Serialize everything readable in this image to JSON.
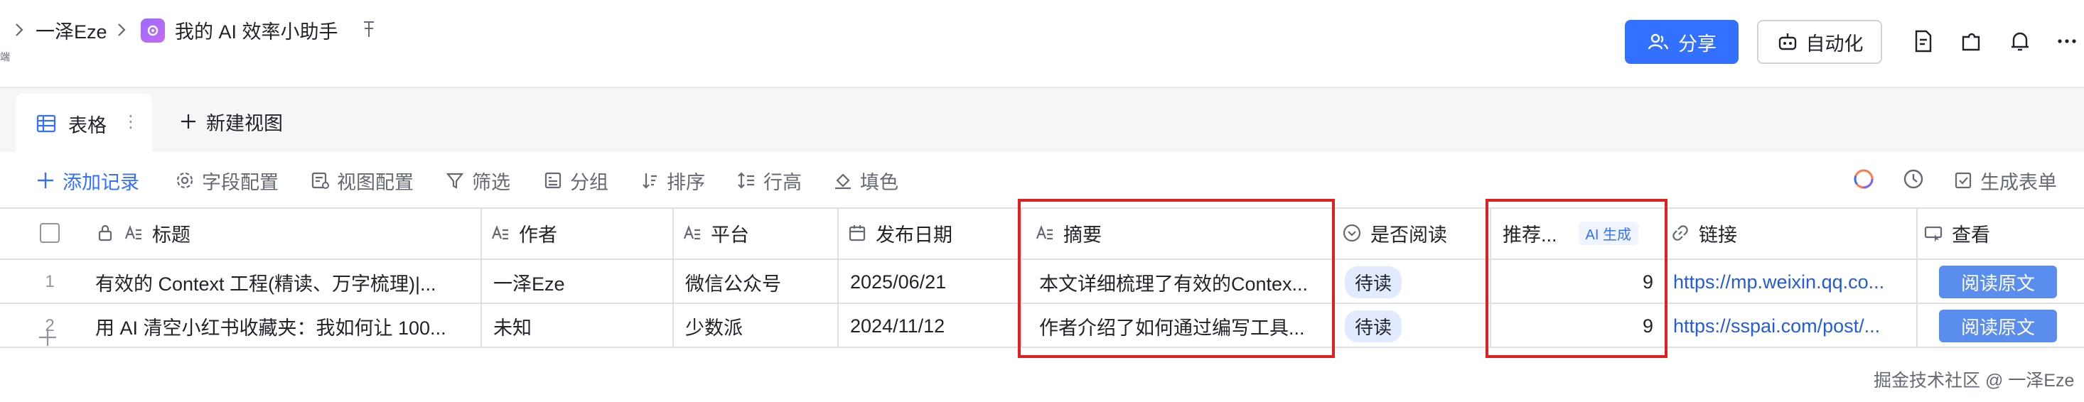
{
  "breadcrumb": {
    "parent": "一泽Eze",
    "title": "我的 AI 效率小助手"
  },
  "header": {
    "share_label": "分享",
    "automation_label": "自动化",
    "side_mark": "端"
  },
  "views": {
    "active_tab": "表格",
    "new_view": "新建视图"
  },
  "toolbar": {
    "add_record": "添加记录",
    "field_config": "字段配置",
    "view_config": "视图配置",
    "filter": "筛选",
    "group": "分组",
    "sort": "排序",
    "row_height": "行高",
    "fill": "填色",
    "generate_form": "生成表单"
  },
  "table": {
    "columns": {
      "title": "标题",
      "author": "作者",
      "platform": "平台",
      "date": "发布日期",
      "summary": "摘要",
      "read": "是否阅读",
      "score": "推荐...",
      "score_badge": "AI 生成",
      "link": "链接",
      "view": "查看"
    },
    "rows": [
      {
        "num": "1",
        "title": "有效的 Context 工程(精读、万字梳理)|...",
        "author": "一泽Eze",
        "platform": "微信公众号",
        "date": "2025/06/21",
        "summary": "本文详细梳理了有效的Contex...",
        "read": "待读",
        "score": "9",
        "link": "https://mp.weixin.qq.co...",
        "view": "阅读原文"
      },
      {
        "num": "2",
        "title": "用 AI 清空小红书收藏夹：我如何让 100...",
        "author": "未知",
        "platform": "少数派",
        "date": "2024/11/12",
        "summary": "作者介绍了如何通过编写工具...",
        "read": "待读",
        "score": "9",
        "link": "https://sspai.com/post/...",
        "view": "阅读原文"
      }
    ]
  },
  "watermark": "掘金技术社区 @ 一泽Eze",
  "colors": {
    "primary": "#3370ff",
    "highlight_box": "#e02020",
    "tag_bg": "#e1eaff"
  }
}
